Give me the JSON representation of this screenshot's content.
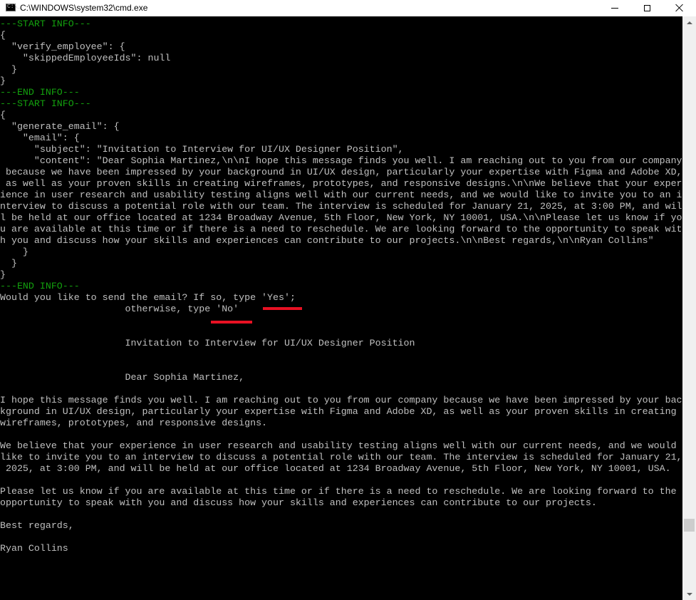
{
  "window": {
    "title": "C:\\WINDOWS\\system32\\cmd.exe",
    "app_icon_glyph": "C:\\_",
    "controls": [
      "minimize",
      "maximize",
      "close"
    ]
  },
  "colors": {
    "background": "#000000",
    "text": "#c0c0c0",
    "marker_text": "#13a10e",
    "highlight": "#e81123"
  },
  "console_lines": [
    {
      "text": "---START INFO---",
      "style": "green"
    },
    {
      "text": "{",
      "style": "normal"
    },
    {
      "text": "  \"verify_employee\": {",
      "style": "normal"
    },
    {
      "text": "    \"skippedEmployeeIds\": null",
      "style": "normal"
    },
    {
      "text": "  }",
      "style": "normal"
    },
    {
      "text": "}",
      "style": "normal"
    },
    {
      "text": "---END INFO---",
      "style": "green"
    },
    {
      "text": "---START INFO---",
      "style": "green"
    },
    {
      "text": "{",
      "style": "normal"
    },
    {
      "text": "  \"generate_email\": {",
      "style": "normal"
    },
    {
      "text": "    \"email\": {",
      "style": "normal"
    },
    {
      "text": "      \"subject\": \"Invitation to Interview for UI/UX Designer Position\",",
      "style": "normal"
    },
    {
      "text": "      \"content\": \"Dear Sophia Martinez,\\n\\nI hope this message finds you well. I am reaching out to you from our company",
      "style": "normal"
    },
    {
      "text": " because we have been impressed by your background in UI/UX design, particularly your expertise with Figma and Adobe XD,",
      "style": "normal"
    },
    {
      "text": " as well as your proven skills in creating wireframes, prototypes, and responsive designs.\\n\\nWe believe that your exper",
      "style": "normal"
    },
    {
      "text": "ience in user research and usability testing aligns well with our current needs, and we would like to invite you to an i",
      "style": "normal"
    },
    {
      "text": "nterview to discuss a potential role with our team. The interview is scheduled for January 21, 2025, at 3:00 PM, and wil",
      "style": "normal"
    },
    {
      "text": "l be held at our office located at 1234 Broadway Avenue, 5th Floor, New York, NY 10001, USA.\\n\\nPlease let us know if yo",
      "style": "normal"
    },
    {
      "text": "u are available at this time or if there is a need to reschedule. We are looking forward to the opportunity to speak wit",
      "style": "normal"
    },
    {
      "text": "h you and discuss how your skills and experiences can contribute to our projects.\\n\\nBest regards,\\n\\nRyan Collins\"",
      "style": "normal"
    },
    {
      "text": "    }",
      "style": "normal"
    },
    {
      "text": "  }",
      "style": "normal"
    },
    {
      "text": "}",
      "style": "normal"
    },
    {
      "text": "---END INFO---",
      "style": "green"
    },
    {
      "text": "Would you like to send the email? If so, type 'Yes';",
      "style": "normal"
    },
    {
      "text": "                      otherwise, type 'No'",
      "style": "normal"
    },
    {
      "text": "",
      "style": "normal"
    },
    {
      "text": "",
      "style": "normal"
    },
    {
      "text": "                      Invitation to Interview for UI/UX Designer Position",
      "style": "normal"
    },
    {
      "text": "",
      "style": "normal"
    },
    {
      "text": "",
      "style": "normal"
    },
    {
      "text": "                      Dear Sophia Martinez,",
      "style": "normal"
    },
    {
      "text": "",
      "style": "normal"
    },
    {
      "text": "I hope this message finds you well. I am reaching out to you from our company because we have been impressed by your bac",
      "style": "normal"
    },
    {
      "text": "kground in UI/UX design, particularly your expertise with Figma and Adobe XD, as well as your proven skills in creating",
      "style": "normal"
    },
    {
      "text": "wireframes, prototypes, and responsive designs.",
      "style": "normal"
    },
    {
      "text": "",
      "style": "normal"
    },
    {
      "text": "We believe that your experience in user research and usability testing aligns well with our current needs, and we would",
      "style": "normal"
    },
    {
      "text": "like to invite you to an interview to discuss a potential role with our team. The interview is scheduled for January 21,",
      "style": "normal"
    },
    {
      "text": " 2025, at 3:00 PM, and will be held at our office located at 1234 Broadway Avenue, 5th Floor, New York, NY 10001, USA.",
      "style": "normal"
    },
    {
      "text": "",
      "style": "normal"
    },
    {
      "text": "Please let us know if you are available at this time or if there is a need to reschedule. We are looking forward to the",
      "style": "normal"
    },
    {
      "text": "opportunity to speak with you and discuss how your skills and experiences can contribute to our projects.",
      "style": "normal"
    },
    {
      "text": "",
      "style": "normal"
    },
    {
      "text": "Best regards,",
      "style": "normal"
    },
    {
      "text": "",
      "style": "normal"
    },
    {
      "text": "Ryan Collins",
      "style": "normal"
    }
  ],
  "annotations": [
    {
      "target": "'Yes'",
      "kind": "underline"
    },
    {
      "target": "'No'",
      "kind": "underline"
    }
  ],
  "scrollbar": {
    "position": "near bottom"
  }
}
